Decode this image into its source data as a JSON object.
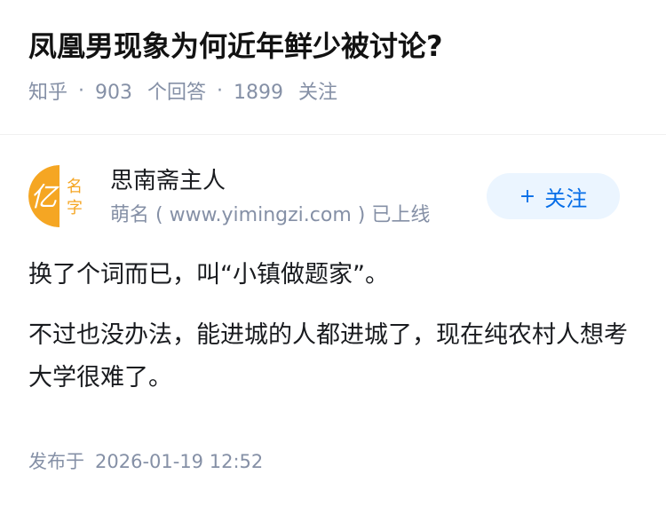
{
  "question": {
    "title": "凤凰男现象为何近年鲜少被讨论?",
    "source": "知乎",
    "separator": "·",
    "answer_count": "903",
    "answer_label": "个回答",
    "follower_count": "1899",
    "follower_label": "关注"
  },
  "author": {
    "name": "思南斋主人",
    "bio": "萌名 ( www.yimingzi.com ) 已上线",
    "avatar_text": [
      "亿",
      "名",
      "字"
    ],
    "avatar_colors": {
      "accent": "#f5a623"
    },
    "follow_button": {
      "icon": "+",
      "label": "关注"
    }
  },
  "answer": {
    "paragraphs": [
      "换了个词而已，叫“小镇做题家”。",
      "不过也没办法，能进城的人都进城了，现在纯农村人想考大学很难了。"
    ]
  },
  "publish": {
    "label": "发布于",
    "datetime": "2026-01-19 12:52"
  }
}
